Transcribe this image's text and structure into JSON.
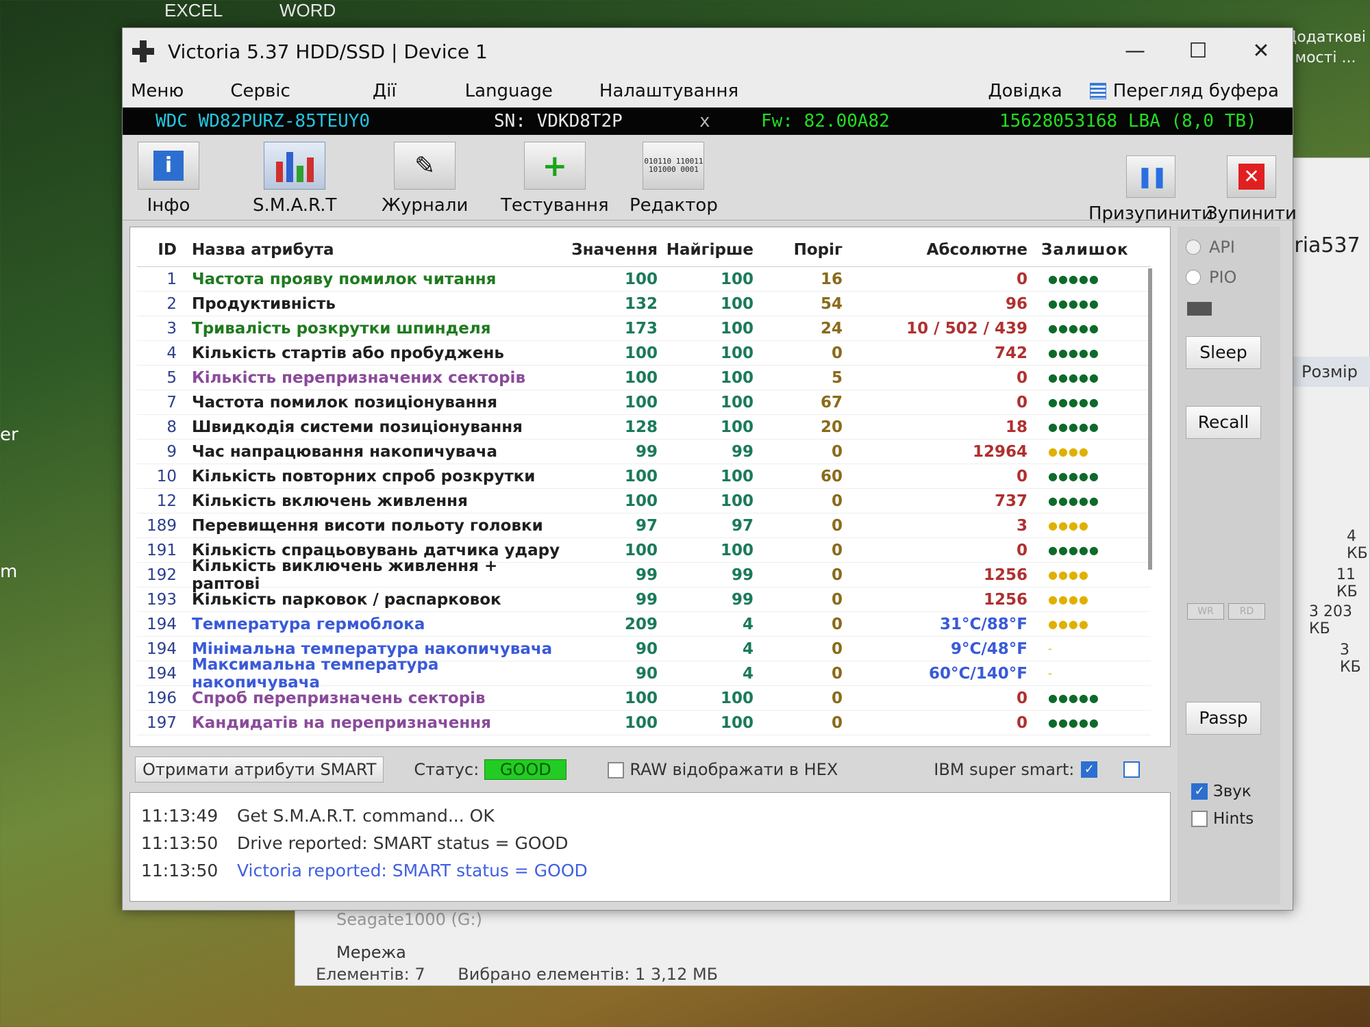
{
  "desktop": {
    "top_labels": [
      "EXCEL",
      "WORD"
    ],
    "right_label": "Додаткові мості ...",
    "left_fragments": [
      "er",
      "m"
    ]
  },
  "explorer": {
    "title_fragment": "oria537",
    "size_header": "Розмір",
    "sizes": [
      "4 КБ",
      "11 КБ",
      "3 203 КБ",
      "3 КБ"
    ],
    "tree_items": [
      "Seagate1000 (G:)",
      "Мережа"
    ],
    "status_items": "Елементів: 7",
    "status_selected": "Вибрано елементів: 1  3,12 МБ"
  },
  "window": {
    "title": "Victoria 5.37 HDD/SSD | Device 1",
    "controls": {
      "minimize": "—",
      "maximize": "☐",
      "close": "✕"
    }
  },
  "menu": {
    "items": [
      "Меню",
      "Сервіс",
      "Дії",
      "Language",
      "Налаштування"
    ],
    "help": "Довідка",
    "buffer": "Перегляд буфера"
  },
  "device": {
    "model": "WDC WD82PURZ-85TEUY0",
    "serial": "SN: VDKD8T2P",
    "x": "x",
    "firmware": "Fw: 82.00A82",
    "lba": "15628053168 LBA (8,0 TB)"
  },
  "toolbar": {
    "info": "Інфо",
    "smart": "S.M.A.R.T",
    "logs": "Журнали",
    "tests": "Тестування",
    "editor": "Редактор",
    "editor_hex": "010110 110011 101000 0001",
    "pause": "Призупинити",
    "stop": "Зупинити"
  },
  "table": {
    "headers": {
      "id": "ID",
      "name": "Назва атрибута",
      "value": "Значення",
      "worst": "Найгірше",
      "threshold": "Поріг",
      "raw": "Абсолютне",
      "remaining": "Залишок"
    },
    "rows": [
      {
        "id": "1",
        "name": "Частота прояву помилок читання",
        "value": "100",
        "worst": "100",
        "threshold": "16",
        "raw": "0",
        "rem": "●●●●●"
      },
      {
        "id": "2",
        "name": "Продуктивність",
        "value": "132",
        "worst": "100",
        "threshold": "54",
        "raw": "96",
        "rem": "●●●●●"
      },
      {
        "id": "3",
        "name": "Тривалість розкрутки шпинделя",
        "value": "173",
        "worst": "100",
        "threshold": "24",
        "raw": "10 / 502 / 439",
        "rem": "●●●●●"
      },
      {
        "id": "4",
        "name": "Кількість стартів або пробуджень",
        "value": "100",
        "worst": "100",
        "threshold": "0",
        "raw": "742",
        "rem": "●●●●●"
      },
      {
        "id": "5",
        "name": "Кількість перепризначених секторів",
        "value": "100",
        "worst": "100",
        "threshold": "5",
        "raw": "0",
        "rem": "●●●●●"
      },
      {
        "id": "7",
        "name": "Частота помилок позиціонування",
        "value": "100",
        "worst": "100",
        "threshold": "67",
        "raw": "0",
        "rem": "●●●●●"
      },
      {
        "id": "8",
        "name": "Швидкодія системи позиціонування",
        "value": "128",
        "worst": "100",
        "threshold": "20",
        "raw": "18",
        "rem": "●●●●●"
      },
      {
        "id": "9",
        "name": "Час напрацювання накопичувача",
        "value": "99",
        "worst": "99",
        "threshold": "0",
        "raw": "12964",
        "rem": "●●●●"
      },
      {
        "id": "10",
        "name": "Кількість повторних спроб розкрутки",
        "value": "100",
        "worst": "100",
        "threshold": "60",
        "raw": "0",
        "rem": "●●●●●"
      },
      {
        "id": "12",
        "name": "Кількість включень живлення",
        "value": "100",
        "worst": "100",
        "threshold": "0",
        "raw": "737",
        "rem": "●●●●●"
      },
      {
        "id": "189",
        "name": "Перевищення висоти польоту головки",
        "value": "97",
        "worst": "97",
        "threshold": "0",
        "raw": "3",
        "rem": "●●●●"
      },
      {
        "id": "191",
        "name": "Кількість спрацьовувань датчика удару",
        "value": "100",
        "worst": "100",
        "threshold": "0",
        "raw": "0",
        "rem": "●●●●●"
      },
      {
        "id": "192",
        "name": "Кількість виключень живлення + раптові",
        "value": "99",
        "worst": "99",
        "threshold": "0",
        "raw": "1256",
        "rem": "●●●●"
      },
      {
        "id": "193",
        "name": "Кількість парковок / распарковок",
        "value": "99",
        "worst": "99",
        "threshold": "0",
        "raw": "1256",
        "rem": "●●●●"
      },
      {
        "id": "194",
        "name": "Температура гермоблока",
        "value": "209",
        "worst": "4",
        "threshold": "0",
        "raw": "31°C/88°F",
        "rem": "●●●●"
      },
      {
        "id": "194",
        "name": "Мінімальна температура накопичувача",
        "value": "90",
        "worst": "4",
        "threshold": "0",
        "raw": "9°C/48°F",
        "rem": "-"
      },
      {
        "id": "194",
        "name": "Максимальна температура накопичувача",
        "value": "90",
        "worst": "4",
        "threshold": "0",
        "raw": "60°C/140°F",
        "rem": "-"
      },
      {
        "id": "196",
        "name": "Спроб перепризначень секторів",
        "value": "100",
        "worst": "100",
        "threshold": "0",
        "raw": "0",
        "rem": "●●●●●"
      },
      {
        "id": "197",
        "name": "Кандидатів на перепризначення",
        "value": "100",
        "worst": "100",
        "threshold": "0",
        "raw": "0",
        "rem": "●●●●●"
      }
    ]
  },
  "bottom": {
    "get_smart": "Отримати атрибути SMART",
    "status_label": "Статус:",
    "status_value": "GOOD",
    "raw_hex": "RAW відображати в HEX",
    "ibm": "IBM super smart:"
  },
  "log": [
    {
      "time": "11:13:49",
      "msg": "Get S.M.A.R.T. command... OK"
    },
    {
      "time": "11:13:50",
      "msg": "Drive reported: SMART status = GOOD"
    },
    {
      "time": "11:13:50",
      "msg": "Victoria reported: SMART status = GOOD"
    }
  ],
  "side": {
    "api": "API",
    "pio": "PIO",
    "sleep": "Sleep",
    "recall": "Recall",
    "wr": "WR",
    "rd": "RD",
    "passp": "Passp",
    "sound": "Звук",
    "hints": "Hints"
  },
  "colors": {
    "good": "#22cc22",
    "model_text": "#22c6e0",
    "firmware_text": "#22dd22",
    "log_blue": "#4060e0"
  }
}
